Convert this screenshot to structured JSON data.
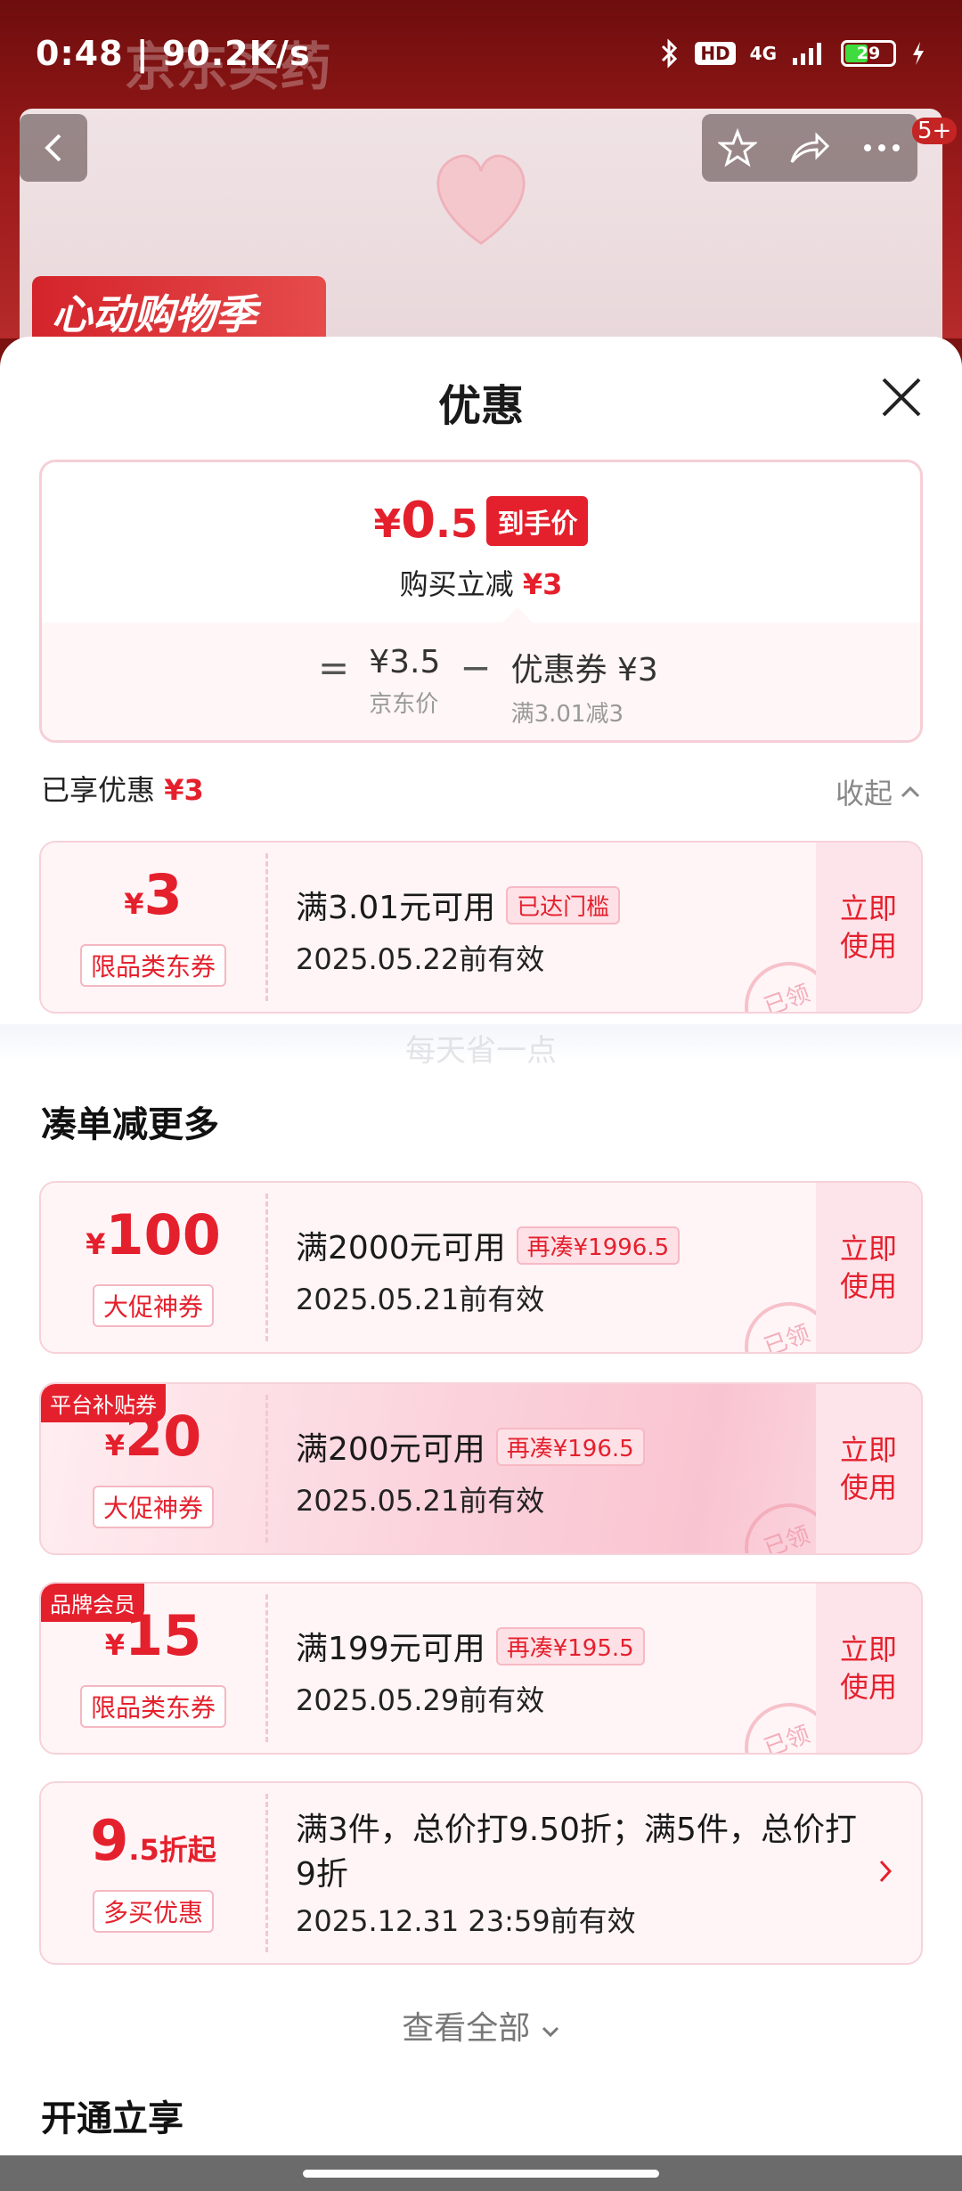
{
  "status_bar": {
    "time_speed": "0:48 | 90.2K/s",
    "hd": "HD",
    "network": "4G",
    "battery": "29"
  },
  "background_page": {
    "ghost_title": "京东买药",
    "badge": "5+",
    "promo_banner": "心动购物季"
  },
  "sheet": {
    "title": "优惠",
    "price_summary": {
      "final_price_yen": "¥",
      "final_price_int": "0",
      "final_price_dec": ".5",
      "final_tag": "到手价",
      "reduce_label": "购买立减",
      "reduce_value": "¥3",
      "equals": "=",
      "jd_price": "¥3.5",
      "jd_price_label": "京东价",
      "minus": "−",
      "coupon_value": "优惠券 ¥3",
      "coupon_cond": "满3.01减3"
    },
    "enjoyed_label": "已享优惠",
    "enjoyed_value": "¥3",
    "collapse_label": "收起",
    "enjoyed_coupons": [
      {
        "yen": "¥",
        "amount": "3",
        "type": "限品类东券",
        "condition": "满3.01元可用",
        "cond_tag": "已达门槛",
        "valid": "2025.05.22前有效",
        "action": "立即使用",
        "stamp": "已领"
      }
    ],
    "watermark": "每天省一点",
    "more_title": "凑单减更多",
    "more_coupons": [
      {
        "corner": "",
        "yen": "¥",
        "amount": "100",
        "type": "大促神券",
        "condition": "满2000元可用",
        "cond_tag": "再凑¥1996.5",
        "valid": "2025.05.21前有效",
        "action": "立即使用",
        "stamp": "已领"
      },
      {
        "corner": "平台补贴券",
        "yen": "¥",
        "amount": "20",
        "type": "大促神券",
        "condition": "满200元可用",
        "cond_tag": "再凑¥196.5",
        "valid": "2025.05.21前有效",
        "action": "立即使用",
        "stamp": "已领"
      },
      {
        "corner": "品牌会员",
        "yen": "¥",
        "amount": "15",
        "type": "限品类东券",
        "condition": "满199元可用",
        "cond_tag": "再凑¥195.5",
        "valid": "2025.05.29前有效",
        "action": "立即使用",
        "stamp": "已领"
      }
    ],
    "discount": {
      "big": "9",
      "small": ".5折起",
      "label": "多买优惠",
      "desc": "满3件，总价打9.50折；满5件，总价打9折",
      "valid": "2025.12.31 23:59前有效"
    },
    "view_all": "查看全部",
    "open_title": "开通立享"
  },
  "colors": {
    "accent_red": "#e5202d",
    "coupon_bg": "#fff5f7"
  }
}
